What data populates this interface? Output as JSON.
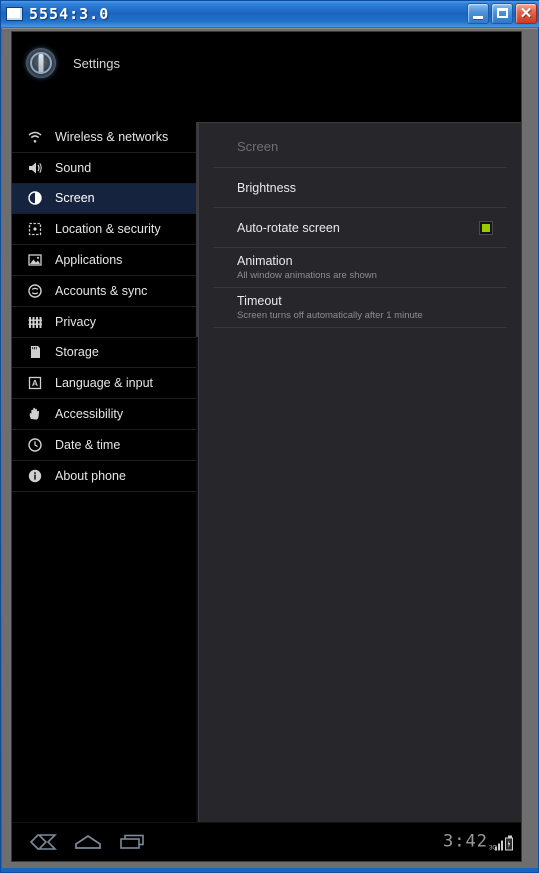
{
  "window": {
    "title": "5554:3.0",
    "icon": "window-icon",
    "buttons": {
      "minimize": "minimize-button",
      "maximize": "maximize-button",
      "close": "✕"
    }
  },
  "app": {
    "header_title": "Settings",
    "header_icon": "settings-gear-icon"
  },
  "sidebar": {
    "items": [
      {
        "label": "Wireless & networks",
        "icon": "wifi-icon",
        "selected": false
      },
      {
        "label": "Sound",
        "icon": "speaker-icon",
        "selected": false
      },
      {
        "label": "Screen",
        "icon": "brightness-icon",
        "selected": true
      },
      {
        "label": "Location & security",
        "icon": "location-grid-icon",
        "selected": false
      },
      {
        "label": "Applications",
        "icon": "applications-image-icon",
        "selected": false
      },
      {
        "label": "Accounts & sync",
        "icon": "sync-icon",
        "selected": false
      },
      {
        "label": "Privacy",
        "icon": "privacy-fence-icon",
        "selected": false
      },
      {
        "label": "Storage",
        "icon": "sdcard-icon",
        "selected": false
      },
      {
        "label": "Language & input",
        "icon": "language-a-icon",
        "selected": false
      },
      {
        "label": "Accessibility",
        "icon": "hand-icon",
        "selected": false
      },
      {
        "label": "Date & time",
        "icon": "clock-icon",
        "selected": false
      },
      {
        "label": "About phone",
        "icon": "info-icon",
        "selected": false
      }
    ]
  },
  "content": {
    "title": "Screen",
    "rows": [
      {
        "title": "Brightness",
        "subtitle": "",
        "control": "none"
      },
      {
        "title": "Auto-rotate screen",
        "subtitle": "",
        "control": "checkbox",
        "checked": true
      },
      {
        "title": "Animation",
        "subtitle": "All window animations are shown",
        "control": "none"
      },
      {
        "title": "Timeout",
        "subtitle": "Screen turns off automatically after 1 minute",
        "control": "none"
      }
    ]
  },
  "navbar": {
    "back": "back-icon",
    "home": "home-icon",
    "recents": "recent-apps-icon",
    "clock": "3:42",
    "network_label": "3G",
    "battery": "battery-charging-icon"
  },
  "colors": {
    "accent_checkbox": "#99cc00",
    "selected_row": "#16233f",
    "panel_bg": "#26262b",
    "sidebar_bg": "#000000",
    "titlebar_blue": "#1b64c0"
  }
}
